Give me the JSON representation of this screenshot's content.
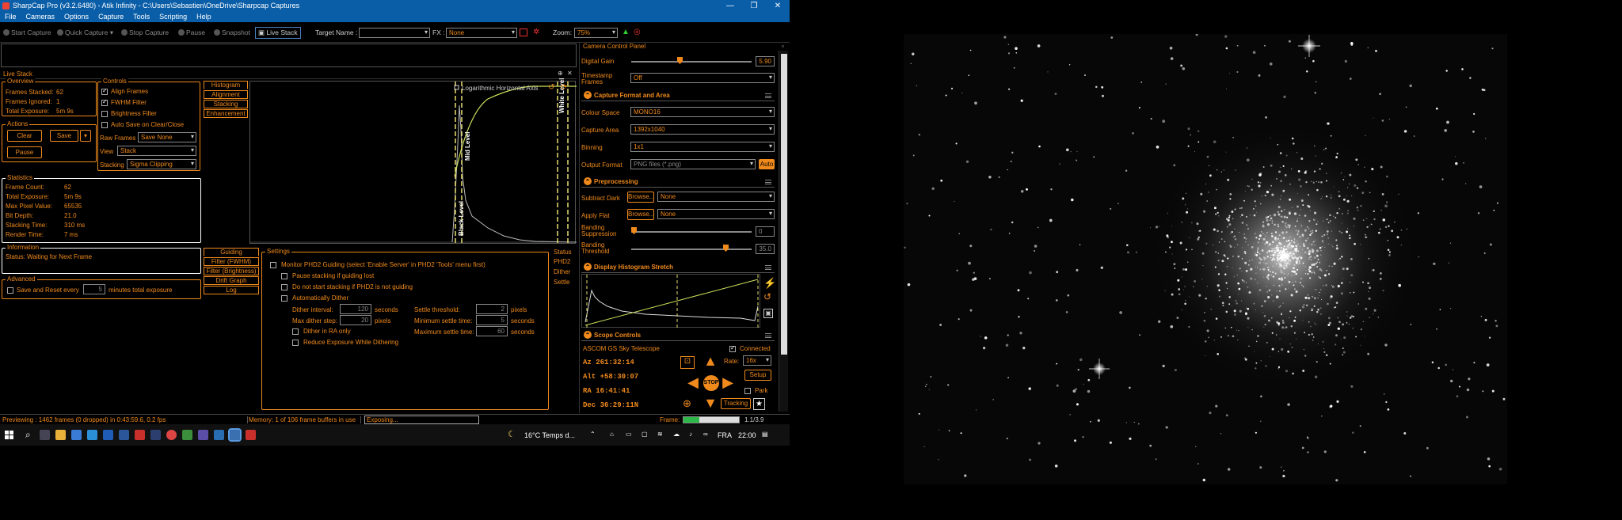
{
  "window": {
    "title": "SharpCap Pro (v3.2.6480) - Atik Infinity - C:\\Users\\Sebastien\\OneDrive\\Sharpcap Captures",
    "minimize": "—",
    "maximize": "❐",
    "close": "✕"
  },
  "menu": [
    "File",
    "Cameras",
    "Options",
    "Capture",
    "Tools",
    "Scripting",
    "Help"
  ],
  "toolbar": {
    "start_capture": "Start Capture",
    "quick_capture": "Quick Capture",
    "stop_capture": "Stop Capture",
    "pause": "Pause",
    "snapshot": "Snapshot",
    "live_stack": "Live Stack",
    "target_label": "Target Name :",
    "target_value": "",
    "fx_label": "FX :",
    "fx_value": "None",
    "zoom_label": "Zoom:",
    "zoom_value": "75%"
  },
  "live_stack": {
    "title": "Live Stack",
    "overview": {
      "title": "Overview",
      "frames_stacked_label": "Frames Stacked:",
      "frames_stacked": "62",
      "frames_ignored_label": "Frames Ignored:",
      "frames_ignored": "1",
      "total_exposure_label": "Total Exposure:",
      "total_exposure": "5m 9s"
    },
    "actions": {
      "title": "Actions",
      "clear": "Clear",
      "save": "Save",
      "pause": "Pause"
    },
    "controls": {
      "title": "Controls",
      "align_frames": "Align Frames",
      "fwhm_filter": "FWHM Filter",
      "brightness_filter": "Brightness Filter",
      "auto_save": "Auto Save on Clear/Close",
      "raw_frames_label": "Raw Frames",
      "raw_frames_value": "Save None",
      "view_label": "View",
      "view_value": "Stack",
      "stacking_label": "Stacking",
      "stacking_value": "Sigma Clipping"
    },
    "tabs_top": [
      "Histogram",
      "Alignment",
      "Stacking",
      "Enhancement"
    ],
    "histogram": {
      "log_axis_label": "Logarithmic Horizontal Axis",
      "mid_level": "Mid Level",
      "white_level": "White Level",
      "black_level": "Black Level"
    },
    "statistics": {
      "title": "Statistics",
      "rows": [
        {
          "label": "Frame Count:",
          "value": "62"
        },
        {
          "label": "Total Exposure:",
          "value": "5m 9s"
        },
        {
          "label": "Max Pixel Value:",
          "value": "65535"
        },
        {
          "label": "Bit Depth:",
          "value": "21.0"
        },
        {
          "label": "Stacking Time:",
          "value": "310 ms"
        },
        {
          "label": "Render Time:",
          "value": "7 ms"
        }
      ]
    },
    "information": {
      "title": "Information",
      "status": "Status: Waiting for Next Frame"
    },
    "advanced": {
      "title": "Advanced",
      "save_reset": "Save and Reset every",
      "minutes_value": "5",
      "minutes_suffix": "minutes total exposure"
    },
    "tabs_bottom": [
      "Guiding",
      "Filter (FWHM)",
      "Filter (Brightness)",
      "Drift Graph",
      "Log"
    ],
    "settings": {
      "title": "Settings",
      "monitor_phd2": "Monitor PHD2 Guiding (select 'Enable Server' in PHD2 'Tools' menu first)",
      "pause_stacking": "Pause stacking if guiding lost",
      "no_start": "Do not start stacking if PHD2 is not guiding",
      "auto_dither": "Automatically Dither",
      "dither_interval_label": "Dither interval:",
      "dither_interval": "120",
      "dither_interval_unit": "seconds",
      "max_dither_label": "Max dither step:",
      "max_dither": "20",
      "max_dither_unit": "pixels",
      "settle_threshold_label": "Settle threshold:",
      "settle_threshold": "2",
      "settle_threshold_unit": "pixels",
      "min_settle_label": "Minimum settle time:",
      "min_settle": "5",
      "min_settle_unit": "seconds",
      "max_settle_label": "Maximum settle time:",
      "max_settle": "60",
      "max_settle_unit": "seconds",
      "dither_ra": "Dither in RA only",
      "reduce_exposure": "Reduce Exposure While Dithering"
    },
    "status_side": {
      "title": "Status",
      "phd2": "PHD2",
      "dither": "Dither",
      "settle": "Settle"
    }
  },
  "camera_control": {
    "title": "Camera Control Panel",
    "digital_gain_label": "Digital Gain",
    "digital_gain": "5.90",
    "digital_gain_level": 0.4,
    "timestamp_label": "Timestamp Frames",
    "timestamp_value": "Off",
    "capture_format": {
      "title": "Capture Format and Area",
      "colour_space_label": "Colour Space",
      "colour_space": "MONO16",
      "capture_area_label": "Capture Area",
      "capture_area": "1392x1040",
      "binning_label": "Binning",
      "binning": "1x1",
      "output_format_label": "Output Format",
      "output_format": "PNG files (*.png)",
      "auto": "Auto"
    },
    "preprocessing": {
      "title": "Preprocessing",
      "subtract_dark_label": "Subtract Dark",
      "apply_flat_label": "Apply Flat",
      "browse": "Browse...",
      "none": "None",
      "banding_supp_label": "Banding Suppression",
      "banding_supp": "0",
      "banding_supp_level": 0.0,
      "banding_thresh_label": "Banding Threshold",
      "banding_thresh": "35.0",
      "banding_thresh_level": 0.8
    },
    "histogram_stretch": {
      "title": "Display Histogram Stretch"
    },
    "scope": {
      "title": "Scope Controls",
      "name": "ASCOM GS Sky Telescope",
      "connected": "Connected",
      "az": "Az   261:32:14",
      "alt": "Alt  +58:30:07",
      "ra": "RA   16:41:41",
      "dec": "Dec  36:29:11N",
      "rate_label": "Rate:",
      "rate": "16x",
      "setup": "Setup",
      "park": "Park",
      "stop": "STOP",
      "tracking": "Tracking"
    },
    "frame_label": "Frame:",
    "frame_value": "1.1/3.9",
    "frame_progress": 0.28
  },
  "status_bar": {
    "preview": "Previewing : 1462 frames (0 dropped) in 0:43:59.6, 0.2 fps",
    "memory": "Memory: 1 of 106 frame buffers in use",
    "exposing": "Exposing..."
  },
  "taskbar": {
    "weather": "16°C  Temps d...",
    "lang": "FRA",
    "time": "22:00"
  },
  "colors": {
    "accent": "#f08a1c",
    "titlebar": "#0a5ea8",
    "background": "#000000"
  }
}
